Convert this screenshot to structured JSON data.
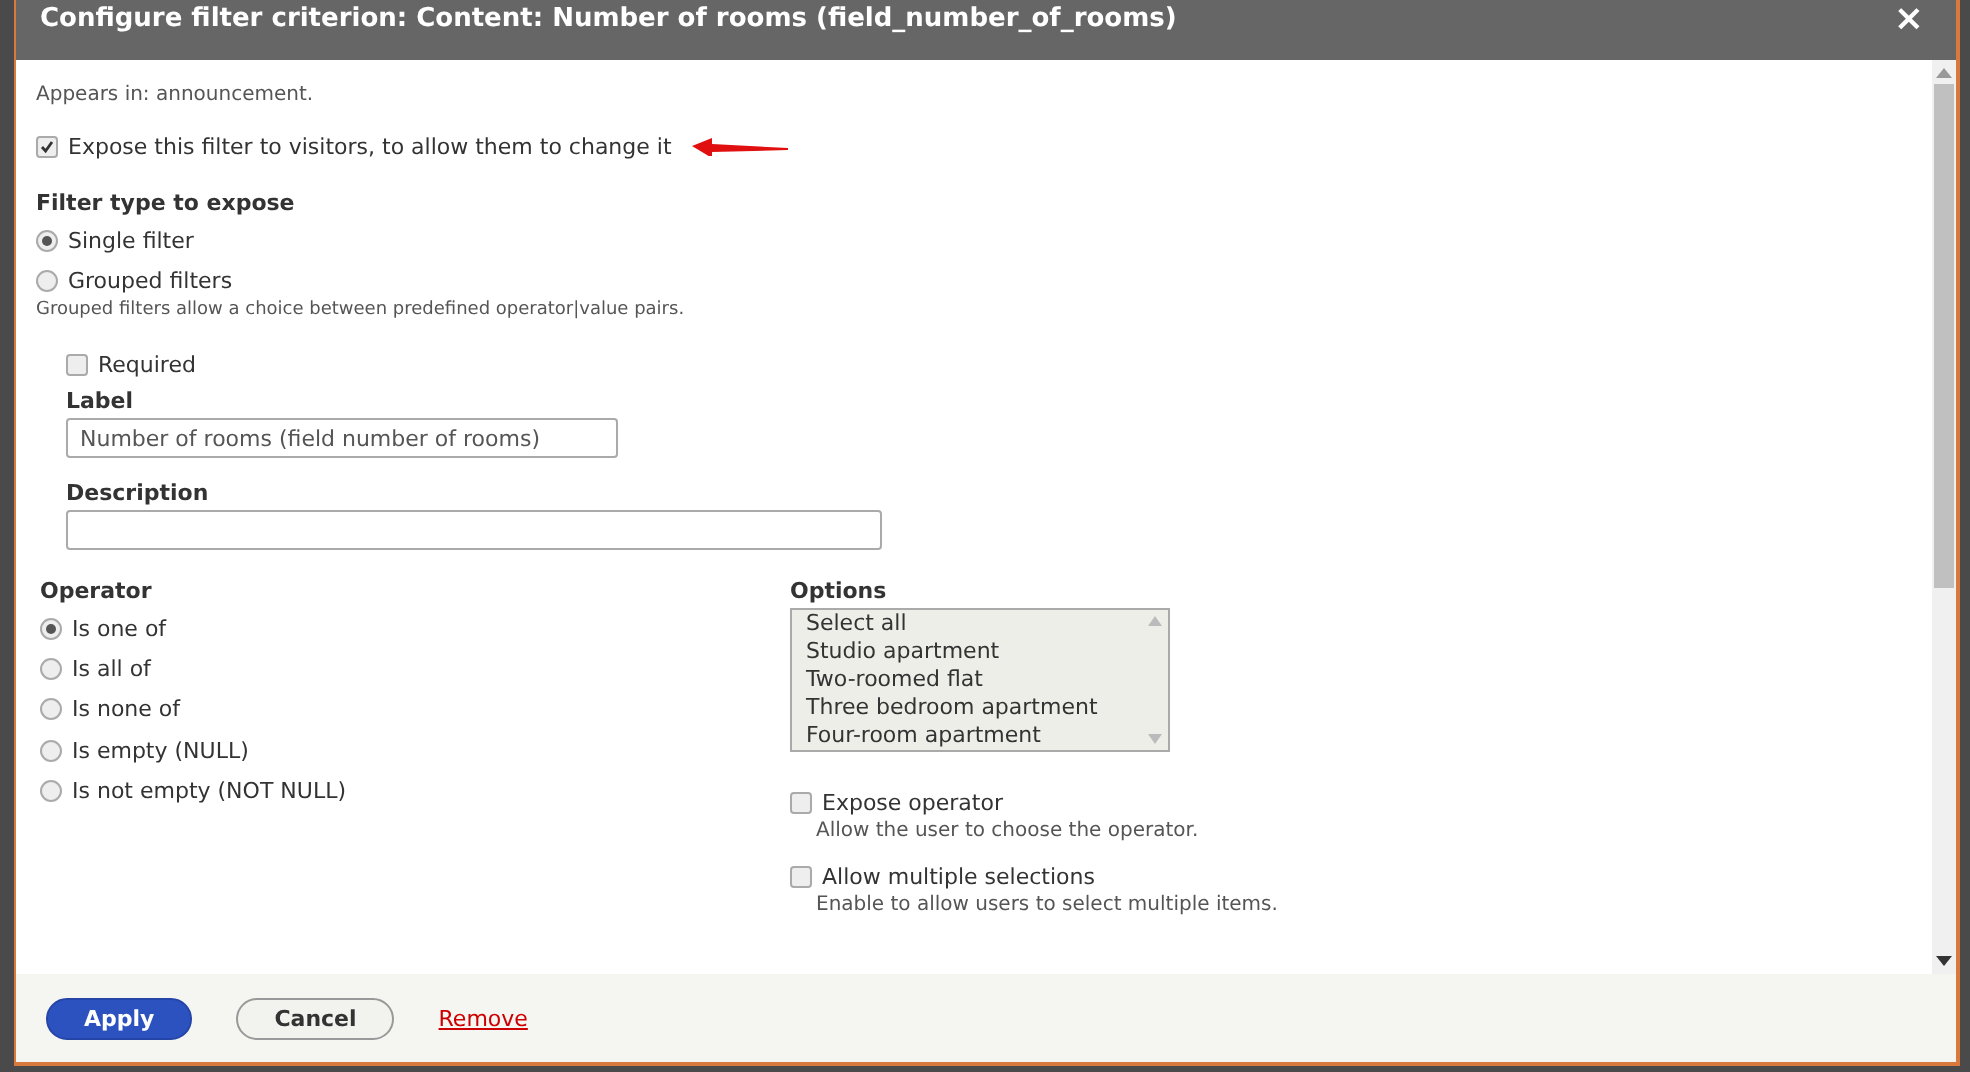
{
  "dialog": {
    "title": "Configure filter criterion: Content: Number of rooms (field_number_of_rooms)",
    "close": "×"
  },
  "appears_in": "Appears in: announcement.",
  "expose": {
    "label": "Expose this filter to visitors, to allow them to change it",
    "checked": true
  },
  "filter_type": {
    "label": "Filter type to expose",
    "hint": "Grouped filters allow a choice between predefined operator|value pairs.",
    "options": [
      {
        "label": "Single filter",
        "selected": true
      },
      {
        "label": "Grouped filters",
        "selected": false
      }
    ]
  },
  "required": {
    "label": "Required",
    "checked": false
  },
  "label_field": {
    "label": "Label",
    "value": "Number of rooms (field number of rooms)"
  },
  "description_field": {
    "label": "Description"
  },
  "operator": {
    "label": "Operator",
    "options": [
      {
        "label": "Is one of",
        "selected": true
      },
      {
        "label": "Is all of",
        "selected": false
      },
      {
        "label": "Is none of",
        "selected": false
      },
      {
        "label": "Is empty (NULL)",
        "selected": false
      },
      {
        "label": "Is not empty (NOT NULL)",
        "selected": false
      }
    ]
  },
  "options": {
    "label": "Options",
    "items": [
      {
        "label": "Select all",
        "selected": false
      },
      {
        "label": "Studio apartment",
        "selected": false
      },
      {
        "label": "Two-roomed flat",
        "selected": false
      },
      {
        "label": "Three bedroom apartment",
        "selected": false
      },
      {
        "label": "Four-room apartment",
        "selected": false
      }
    ]
  },
  "toggles": [
    {
      "label": "Expose operator",
      "checked": false,
      "hint": "Allow the user to choose the operator."
    },
    {
      "label": "Allow multiple selections",
      "checked": false,
      "hint": "Enable to allow users to select multiple items."
    }
  ],
  "buttons": [
    {
      "label": "Apply",
      "kind": "primary"
    },
    {
      "label": "Cancel",
      "kind": "secondary"
    },
    {
      "label": "Remove",
      "kind": "link"
    }
  ]
}
